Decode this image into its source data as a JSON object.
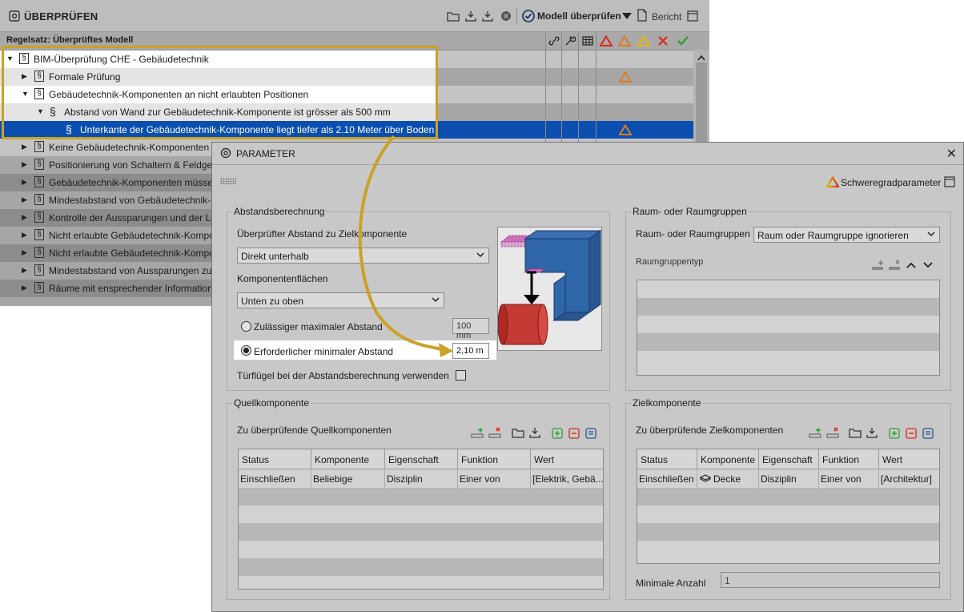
{
  "check_panel": {
    "title": "ÜBERPRÜFEN",
    "model_check_label": "Modell überprüfen",
    "report_label": "Bericht",
    "ruleset_label": "Regelsatz: Überprüftes Modell",
    "tree": [
      {
        "label": "BIM-Überprüfung CHE - Gebäudetechnik",
        "arrow": "▼"
      },
      {
        "label": "Formale Prüfung",
        "arrow": "▶"
      },
      {
        "label": "Gebäudetechnik-Komponenten an nicht erlaubten Positionen",
        "arrow": "▼"
      },
      {
        "label": "Abstand von Wand zur Gebäudetechnik-Komponente ist grösser als 500 mm",
        "arrow": "▼"
      },
      {
        "label": "Unterkante der Gebäudetechnik-Komponente liegt tiefer als 2.10 Meter über Boden",
        "arrow": ""
      },
      {
        "label": "Keine Gebäudetechnik-Komponenten vo",
        "arrow": "▶"
      },
      {
        "label": "Positionierung von Schaltern & Feldger",
        "arrow": "▶"
      },
      {
        "label": "Gebäudetechnik-Komponenten müssen",
        "arrow": "▶"
      },
      {
        "label": "Mindestabstand von Gebäudetechnik-K",
        "arrow": "▶"
      },
      {
        "label": "Kontrolle der Aussparungen und der Le",
        "arrow": "▶"
      },
      {
        "label": "Nicht erlaubte Gebäudetechnik-Kompor",
        "arrow": "▶"
      },
      {
        "label": "Nicht erlaubte Gebäudetechnik-Kompor",
        "arrow": "▶"
      },
      {
        "label": "Mindestabstand von Aussparungen zur",
        "arrow": "▶"
      },
      {
        "label": "Räume mit ensprechender Information",
        "arrow": "▶"
      }
    ]
  },
  "param_dialog": {
    "title": "PARAMETER",
    "severity_label": "Schweregradparameter",
    "distance_group": {
      "title": "Abstandsberechnung",
      "checked_distance_label": "Überprüfter Abstand zu Zielkomponente",
      "checked_distance_value": "Direkt unterhalb",
      "surfaces_label": "Komponentenflächen",
      "surfaces_value": "Unten zu oben",
      "max_distance_label": "Zulässiger maximaler Abstand",
      "max_distance_value": "100 mm",
      "min_distance_label": "Erforderlicher minimaler Abstand",
      "min_distance_value": "2,10 m",
      "door_wing_label": "Türflügel bei der Abstandsberechnung verwenden"
    },
    "room_group": {
      "title": "Raum- oder Raumgruppen",
      "label": "Raum- oder Raumgruppen",
      "value": "Raum oder Raumgruppe ignorieren",
      "type_label": "Raumgruppentyp"
    },
    "source_group": {
      "title": "Quellkomponente",
      "list_label": "Zu überprüfende Quellkomponenten",
      "columns": [
        "Status",
        "Komponente",
        "Eigenschaft",
        "Funktion",
        "Wert"
      ],
      "row": [
        "Einschließen",
        "Beliebige",
        "Disziplin",
        "Einer von",
        "[Elektrik, Gebä..."
      ]
    },
    "target_group": {
      "title": "Zielkomponente",
      "list_label": "Zu überprüfende Zielkomponenten",
      "columns": [
        "Status",
        "Komponente",
        "Eigenschaft",
        "Funktion",
        "Wert"
      ],
      "row": [
        "Einschließen",
        "Decke",
        "Disziplin",
        "Einer von",
        "[Architektur]"
      ],
      "min_count_label": "Minimale Anzahl",
      "min_count_value": "1"
    }
  },
  "colors": {
    "accent_gold": "#c9a227",
    "selected_row": "#0a4fb0",
    "warn_red": "#d62a1c",
    "warn_orange": "#e07b1a",
    "warn_yellow": "#e6b800",
    "ok_green": "#2ca02c"
  }
}
